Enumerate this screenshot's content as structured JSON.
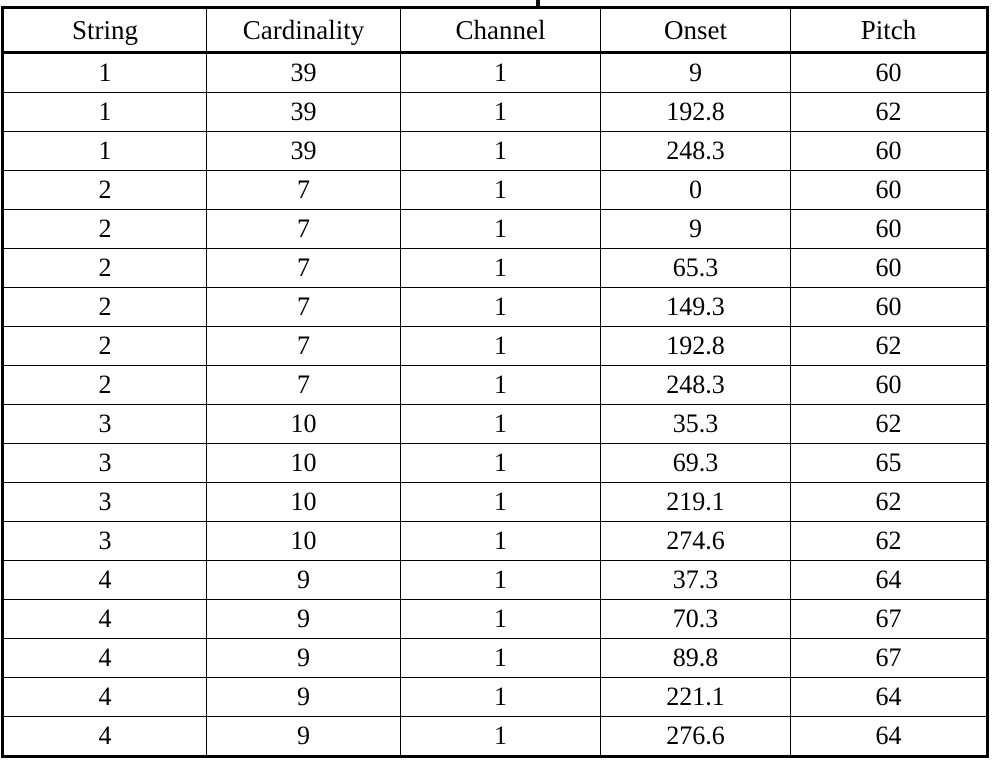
{
  "artifact": {
    "name": "clipped-caption-descender",
    "color": "#121212"
  },
  "table": {
    "name": "note-event-table",
    "columns": [
      {
        "key": "string",
        "label": "String"
      },
      {
        "key": "cardinality",
        "label": "Cardinality"
      },
      {
        "key": "channel",
        "label": "Channel"
      },
      {
        "key": "onset",
        "label": "Onset"
      },
      {
        "key": "pitch",
        "label": "Pitch"
      }
    ],
    "rows": [
      {
        "string": "1",
        "cardinality": "39",
        "channel": "1",
        "onset": "9",
        "pitch": "60"
      },
      {
        "string": "1",
        "cardinality": "39",
        "channel": "1",
        "onset": "192.8",
        "pitch": "62"
      },
      {
        "string": "1",
        "cardinality": "39",
        "channel": "1",
        "onset": "248.3",
        "pitch": "60"
      },
      {
        "string": "2",
        "cardinality": "7",
        "channel": "1",
        "onset": "0",
        "pitch": "60"
      },
      {
        "string": "2",
        "cardinality": "7",
        "channel": "1",
        "onset": "9",
        "pitch": "60"
      },
      {
        "string": "2",
        "cardinality": "7",
        "channel": "1",
        "onset": "65.3",
        "pitch": "60"
      },
      {
        "string": "2",
        "cardinality": "7",
        "channel": "1",
        "onset": "149.3",
        "pitch": "60"
      },
      {
        "string": "2",
        "cardinality": "7",
        "channel": "1",
        "onset": "192.8",
        "pitch": "62"
      },
      {
        "string": "2",
        "cardinality": "7",
        "channel": "1",
        "onset": "248.3",
        "pitch": "60"
      },
      {
        "string": "3",
        "cardinality": "10",
        "channel": "1",
        "onset": "35.3",
        "pitch": "62"
      },
      {
        "string": "3",
        "cardinality": "10",
        "channel": "1",
        "onset": "69.3",
        "pitch": "65"
      },
      {
        "string": "3",
        "cardinality": "10",
        "channel": "1",
        "onset": "219.1",
        "pitch": "62"
      },
      {
        "string": "3",
        "cardinality": "10",
        "channel": "1",
        "onset": "274.6",
        "pitch": "62"
      },
      {
        "string": "4",
        "cardinality": "9",
        "channel": "1",
        "onset": "37.3",
        "pitch": "64"
      },
      {
        "string": "4",
        "cardinality": "9",
        "channel": "1",
        "onset": "70.3",
        "pitch": "67"
      },
      {
        "string": "4",
        "cardinality": "9",
        "channel": "1",
        "onset": "89.8",
        "pitch": "67"
      },
      {
        "string": "4",
        "cardinality": "9",
        "channel": "1",
        "onset": "221.1",
        "pitch": "64"
      },
      {
        "string": "4",
        "cardinality": "9",
        "channel": "1",
        "onset": "276.6",
        "pitch": "64"
      }
    ]
  }
}
